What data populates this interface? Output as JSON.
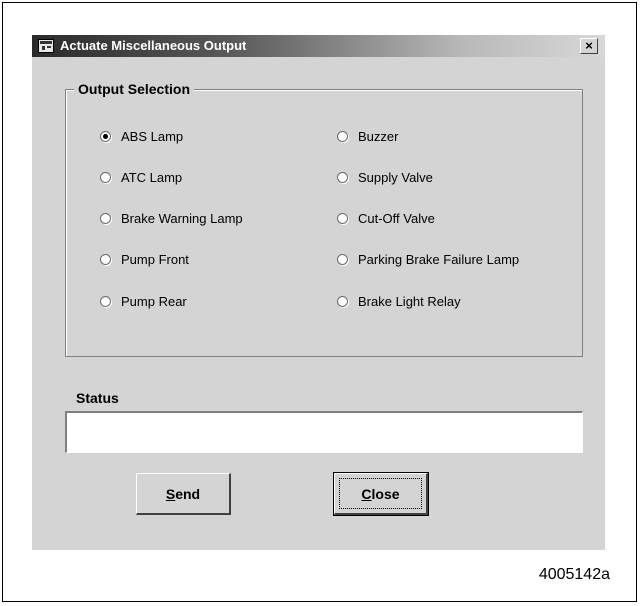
{
  "window": {
    "title": "Actuate Miscellaneous Output",
    "close_glyph": "×"
  },
  "output_selection": {
    "label": "Output Selection",
    "left_column": [
      {
        "label": "ABS Lamp",
        "checked": true
      },
      {
        "label": "ATC Lamp",
        "checked": false
      },
      {
        "label": "Brake Warning Lamp",
        "checked": false
      },
      {
        "label": "Pump Front",
        "checked": false
      },
      {
        "label": "Pump Rear",
        "checked": false
      }
    ],
    "right_column": [
      {
        "label": "Buzzer",
        "checked": false
      },
      {
        "label": "Supply Valve",
        "checked": false
      },
      {
        "label": "Cut-Off Valve",
        "checked": false
      },
      {
        "label": "Parking Brake Failure Lamp",
        "checked": false
      },
      {
        "label": "Brake Light Relay",
        "checked": false
      }
    ]
  },
  "status": {
    "label": "Status",
    "value": ""
  },
  "buttons": {
    "send_mnemonic": "S",
    "send_rest": "end",
    "close_mnemonic": "C",
    "close_rest": "lose"
  },
  "figure_id": "4005142a"
}
